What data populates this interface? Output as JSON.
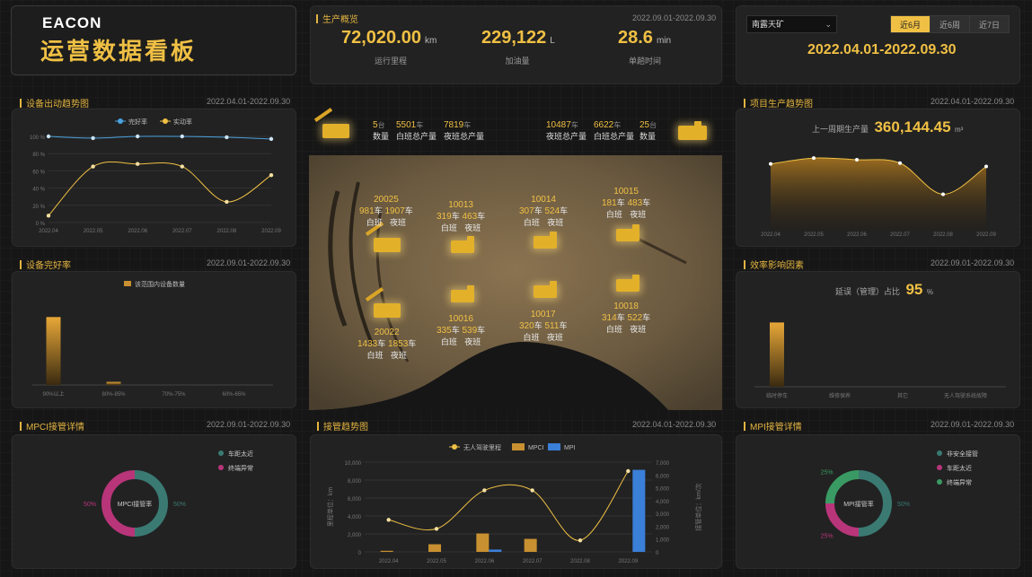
{
  "brand": {
    "logo": "EACON",
    "title": "运营数据看板"
  },
  "overview": {
    "title": "生产概览",
    "date": "2022.09.01-2022.09.30",
    "stats": [
      {
        "value": "72,020.00",
        "unit": "km",
        "label": "运行里程"
      },
      {
        "value": "229,122",
        "unit": "L",
        "label": "加油量"
      },
      {
        "value": "28.6",
        "unit": "min",
        "label": "单趟时间"
      }
    ]
  },
  "filter": {
    "site": "南露天矿",
    "tabs": [
      "近6月",
      "近6周",
      "近7日"
    ],
    "active_tab": "近6月",
    "range": "2022.04.01-2022.09.30"
  },
  "panels": {
    "dispatch": {
      "title": "设备出动趋势图",
      "date": "2022.04.01-2022.09.30"
    },
    "health": {
      "title": "设备完好率",
      "date": "2022.09.01-2022.09.30"
    },
    "mpci": {
      "title": "MPCI接管详情",
      "date": "2022.09.01-2022.09.30"
    },
    "takeover": {
      "title": "接管趋势图",
      "date": "2022.04.01-2022.09.30"
    },
    "production": {
      "title": "项目生产趋势图",
      "date": "2022.04.01-2022.09.30"
    },
    "efficiency": {
      "title": "效率影响因素",
      "date": "2022.09.01-2022.09.30"
    },
    "mpi": {
      "title": "MPI接管详情",
      "date": "2022.09.01-2022.09.30"
    }
  },
  "fleet": {
    "left": [
      {
        "num": "5",
        "unit": "台",
        "label": "数量"
      },
      {
        "num": "5501",
        "unit": "车",
        "label": "白班总产量"
      },
      {
        "num": "7819",
        "unit": "车",
        "label": "夜班总产量"
      }
    ],
    "right": [
      {
        "num": "10487",
        "unit": "车",
        "label": "夜班总产量"
      },
      {
        "num": "6622",
        "unit": "车",
        "label": "白班总产量"
      },
      {
        "num": "25",
        "unit": "台",
        "label": "数量"
      }
    ]
  },
  "map_units": [
    {
      "id": "20025",
      "day": "981",
      "night": "1907"
    },
    {
      "id": "10013",
      "day": "319",
      "night": "463"
    },
    {
      "id": "10014",
      "day": "307",
      "night": "524"
    },
    {
      "id": "10015",
      "day": "181",
      "night": "483"
    },
    {
      "id": "20022",
      "day": "1433",
      "night": "1853"
    },
    {
      "id": "10016",
      "day": "335",
      "night": "539"
    },
    {
      "id": "10017",
      "day": "320",
      "night": "511"
    },
    {
      "id": "10018",
      "day": "314",
      "night": "522"
    }
  ],
  "map_text": {
    "car": "车",
    "day": "白班",
    "night": "夜班"
  },
  "production_summary": {
    "label": "上一周期生产量",
    "value": "360,144.45",
    "unit": "m³"
  },
  "efficiency_summary": {
    "label": "延误（管理）占比",
    "value": "95",
    "unit": "%"
  },
  "chart_data": [
    {
      "type": "line",
      "id": "dispatch",
      "categories": [
        "2022.04",
        "2022.05",
        "2022.06",
        "2022.07",
        "2022.08",
        "2022.09"
      ],
      "series": [
        {
          "name": "完好率",
          "values": [
            100,
            98,
            100,
            100,
            99,
            97
          ],
          "color": "#4aa3e0"
        },
        {
          "name": "实动率",
          "values": [
            8,
            65,
            68,
            65,
            24,
            55
          ],
          "color": "#f0c044"
        }
      ],
      "ylim": [
        0,
        100
      ],
      "yticks": [
        "0 %",
        "20 %",
        "40 %",
        "60 %",
        "80 %",
        "100 %"
      ]
    },
    {
      "type": "bar",
      "id": "health",
      "categories": [
        "90%以上",
        "80%-85%",
        "70%-75%",
        "60%-65%"
      ],
      "series": [
        {
          "name": "该范围内设备数量",
          "values": [
            22,
            1,
            0,
            0
          ]
        }
      ],
      "ylim": [
        0,
        25
      ]
    },
    {
      "type": "pie",
      "id": "mpci",
      "center_label": "MPCI接管率",
      "slices": [
        {
          "name": "车距太近",
          "value": 50,
          "label": "50%",
          "color": "#3a7a73"
        },
        {
          "name": "终端异常",
          "value": 50,
          "label": "50%",
          "color": "#b8357a"
        }
      ]
    },
    {
      "type": "bar",
      "id": "takeover",
      "categories": [
        "2022.04",
        "2022.05",
        "2022.06",
        "2022.07",
        "2022.08",
        "2022.09"
      ],
      "series": [
        {
          "name": "无人驾驶里程",
          "type": "line",
          "values": [
            2500,
            1800,
            4800,
            4800,
            900,
            6300
          ],
          "color": "#f0c044"
        },
        {
          "name": "MPCI",
          "values": [
            120,
            850,
            2050,
            1450,
            0,
            0
          ],
          "color": "#c89030"
        },
        {
          "name": "MPI",
          "values": [
            0,
            0,
            180,
            0,
            0,
            6400
          ],
          "color": "#3a7fd8"
        }
      ],
      "ylabel": "里程单位：km",
      "ylabel_right": "接管单位：km/次",
      "yticks": [
        "0",
        "2,000",
        "4,000",
        "6,000",
        "8,000",
        "10,000"
      ],
      "yticks_right": [
        "0",
        "1,000",
        "2,000",
        "3,000",
        "4,000",
        "5,000",
        "6,000",
        "7,000"
      ],
      "ylim": [
        0,
        10000
      ],
      "ylim_right": [
        0,
        7000
      ]
    },
    {
      "type": "area",
      "id": "production",
      "categories": [
        "2022.04",
        "2022.05",
        "2022.06",
        "2022.07",
        "2022.08",
        "2022.09"
      ],
      "series": [
        {
          "name": "生产量",
          "values": [
            78,
            85,
            83,
            79,
            42,
            75
          ]
        }
      ],
      "ylim": [
        0,
        100
      ]
    },
    {
      "type": "bar",
      "id": "efficiency",
      "categories": [
        "临时停车",
        "维修保养",
        "其它",
        "无人驾驶系统故障"
      ],
      "series": [
        {
          "name": "占比",
          "values": [
            95,
            0,
            0,
            0
          ]
        }
      ],
      "ylim": [
        0,
        130
      ]
    },
    {
      "type": "pie",
      "id": "mpi",
      "center_label": "MPI接管率",
      "slices": [
        {
          "name": "非安全接管",
          "value": 50,
          "label": "50%",
          "color": "#3a7a73"
        },
        {
          "name": "车距太近",
          "value": 25,
          "label": "25%",
          "color": "#b8357a"
        },
        {
          "name": "终端异常",
          "value": 25,
          "label": "25%",
          "color": "#3a9a63"
        }
      ]
    }
  ]
}
